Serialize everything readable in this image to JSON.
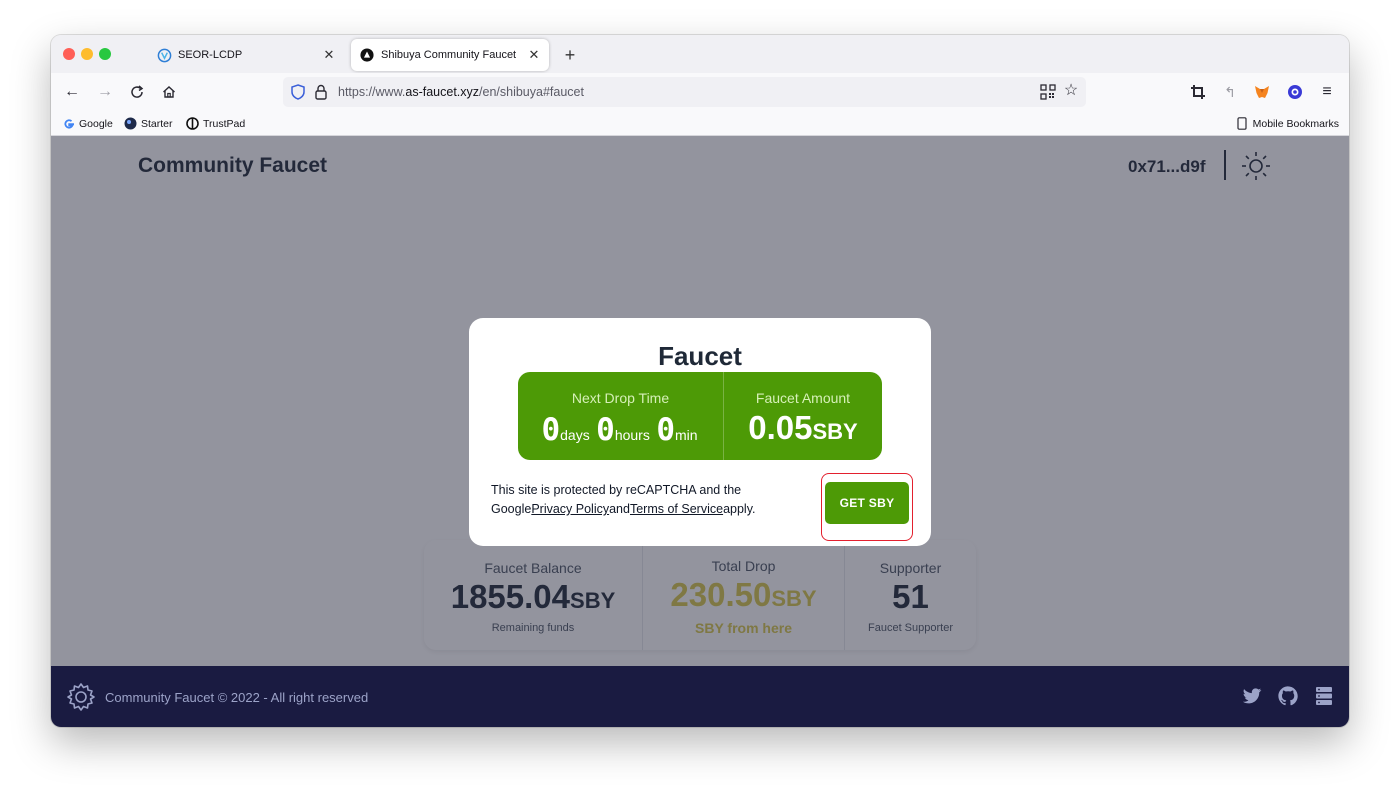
{
  "browser": {
    "tabs": [
      {
        "title": "SEOR-LCDP",
        "icon": "seor-logo-icon",
        "active": false
      },
      {
        "title": "Shibuya Community Faucet",
        "icon": "shibuya-logo-icon",
        "active": true
      }
    ],
    "url": {
      "prefix": "https://www.",
      "domain": "as-faucet.xyz",
      "path": "/en/shibuya#faucet"
    },
    "bookmarks": [
      {
        "label": "Google",
        "icon": "google-icon"
      },
      {
        "label": "Starter",
        "icon": "starter-icon"
      },
      {
        "label": "TrustPad",
        "icon": "trustpad-icon"
      }
    ],
    "mobile_bookmarks": "Mobile Bookmarks"
  },
  "header": {
    "title": "Community Faucet",
    "address": "0x71...d9f"
  },
  "modal": {
    "title": "Faucet",
    "next_drop": {
      "label": "Next Drop Time",
      "days": "0",
      "days_unit": "days",
      "hours": "0",
      "hours_unit": "hours",
      "min": "0",
      "min_unit": "min"
    },
    "amount": {
      "label": "Faucet Amount",
      "value": "0.05",
      "unit": "SBY"
    },
    "captcha": {
      "prefix": "This site is protected by reCAPTCHA and the Google",
      "privacy": "Privacy Policy",
      "and": "and",
      "terms": "Terms of Service",
      "suffix": "apply."
    },
    "button": "GET SBY"
  },
  "stats": [
    {
      "label": "Faucet Balance",
      "value": "1855.04",
      "unit": "SBY",
      "desc": "Remaining funds"
    },
    {
      "label": "Total Drop",
      "value": "230.50",
      "unit": "SBY",
      "desc": "SBY from here"
    },
    {
      "label": "Supporter",
      "value": "51",
      "unit": "",
      "desc": "Faucet Supporter"
    }
  ],
  "footer": {
    "text": "Community Faucet © 2022 - All right reserved"
  },
  "colors": {
    "accent_green": "#4d9a06",
    "footer_bg": "#1a1b41",
    "highlight_red": "#e3202e",
    "gold": "#d6c74a"
  }
}
